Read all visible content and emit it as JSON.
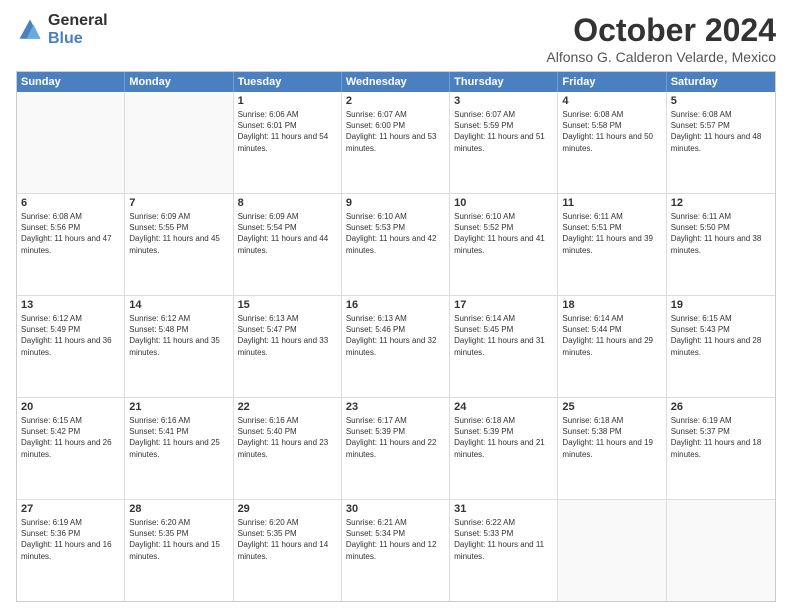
{
  "logo": {
    "general": "General",
    "blue": "Blue"
  },
  "header": {
    "month": "October 2024",
    "location": "Alfonso G. Calderon Velarde, Mexico"
  },
  "weekdays": [
    "Sunday",
    "Monday",
    "Tuesday",
    "Wednesday",
    "Thursday",
    "Friday",
    "Saturday"
  ],
  "weeks": [
    [
      {
        "day": "",
        "sunrise": "",
        "sunset": "",
        "daylight": ""
      },
      {
        "day": "",
        "sunrise": "",
        "sunset": "",
        "daylight": ""
      },
      {
        "day": "1",
        "sunrise": "Sunrise: 6:06 AM",
        "sunset": "Sunset: 6:01 PM",
        "daylight": "Daylight: 11 hours and 54 minutes."
      },
      {
        "day": "2",
        "sunrise": "Sunrise: 6:07 AM",
        "sunset": "Sunset: 6:00 PM",
        "daylight": "Daylight: 11 hours and 53 minutes."
      },
      {
        "day": "3",
        "sunrise": "Sunrise: 6:07 AM",
        "sunset": "Sunset: 5:59 PM",
        "daylight": "Daylight: 11 hours and 51 minutes."
      },
      {
        "day": "4",
        "sunrise": "Sunrise: 6:08 AM",
        "sunset": "Sunset: 5:58 PM",
        "daylight": "Daylight: 11 hours and 50 minutes."
      },
      {
        "day": "5",
        "sunrise": "Sunrise: 6:08 AM",
        "sunset": "Sunset: 5:57 PM",
        "daylight": "Daylight: 11 hours and 48 minutes."
      }
    ],
    [
      {
        "day": "6",
        "sunrise": "Sunrise: 6:08 AM",
        "sunset": "Sunset: 5:56 PM",
        "daylight": "Daylight: 11 hours and 47 minutes."
      },
      {
        "day": "7",
        "sunrise": "Sunrise: 6:09 AM",
        "sunset": "Sunset: 5:55 PM",
        "daylight": "Daylight: 11 hours and 45 minutes."
      },
      {
        "day": "8",
        "sunrise": "Sunrise: 6:09 AM",
        "sunset": "Sunset: 5:54 PM",
        "daylight": "Daylight: 11 hours and 44 minutes."
      },
      {
        "day": "9",
        "sunrise": "Sunrise: 6:10 AM",
        "sunset": "Sunset: 5:53 PM",
        "daylight": "Daylight: 11 hours and 42 minutes."
      },
      {
        "day": "10",
        "sunrise": "Sunrise: 6:10 AM",
        "sunset": "Sunset: 5:52 PM",
        "daylight": "Daylight: 11 hours and 41 minutes."
      },
      {
        "day": "11",
        "sunrise": "Sunrise: 6:11 AM",
        "sunset": "Sunset: 5:51 PM",
        "daylight": "Daylight: 11 hours and 39 minutes."
      },
      {
        "day": "12",
        "sunrise": "Sunrise: 6:11 AM",
        "sunset": "Sunset: 5:50 PM",
        "daylight": "Daylight: 11 hours and 38 minutes."
      }
    ],
    [
      {
        "day": "13",
        "sunrise": "Sunrise: 6:12 AM",
        "sunset": "Sunset: 5:49 PM",
        "daylight": "Daylight: 11 hours and 36 minutes."
      },
      {
        "day": "14",
        "sunrise": "Sunrise: 6:12 AM",
        "sunset": "Sunset: 5:48 PM",
        "daylight": "Daylight: 11 hours and 35 minutes."
      },
      {
        "day": "15",
        "sunrise": "Sunrise: 6:13 AM",
        "sunset": "Sunset: 5:47 PM",
        "daylight": "Daylight: 11 hours and 33 minutes."
      },
      {
        "day": "16",
        "sunrise": "Sunrise: 6:13 AM",
        "sunset": "Sunset: 5:46 PM",
        "daylight": "Daylight: 11 hours and 32 minutes."
      },
      {
        "day": "17",
        "sunrise": "Sunrise: 6:14 AM",
        "sunset": "Sunset: 5:45 PM",
        "daylight": "Daylight: 11 hours and 31 minutes."
      },
      {
        "day": "18",
        "sunrise": "Sunrise: 6:14 AM",
        "sunset": "Sunset: 5:44 PM",
        "daylight": "Daylight: 11 hours and 29 minutes."
      },
      {
        "day": "19",
        "sunrise": "Sunrise: 6:15 AM",
        "sunset": "Sunset: 5:43 PM",
        "daylight": "Daylight: 11 hours and 28 minutes."
      }
    ],
    [
      {
        "day": "20",
        "sunrise": "Sunrise: 6:15 AM",
        "sunset": "Sunset: 5:42 PM",
        "daylight": "Daylight: 11 hours and 26 minutes."
      },
      {
        "day": "21",
        "sunrise": "Sunrise: 6:16 AM",
        "sunset": "Sunset: 5:41 PM",
        "daylight": "Daylight: 11 hours and 25 minutes."
      },
      {
        "day": "22",
        "sunrise": "Sunrise: 6:16 AM",
        "sunset": "Sunset: 5:40 PM",
        "daylight": "Daylight: 11 hours and 23 minutes."
      },
      {
        "day": "23",
        "sunrise": "Sunrise: 6:17 AM",
        "sunset": "Sunset: 5:39 PM",
        "daylight": "Daylight: 11 hours and 22 minutes."
      },
      {
        "day": "24",
        "sunrise": "Sunrise: 6:18 AM",
        "sunset": "Sunset: 5:39 PM",
        "daylight": "Daylight: 11 hours and 21 minutes."
      },
      {
        "day": "25",
        "sunrise": "Sunrise: 6:18 AM",
        "sunset": "Sunset: 5:38 PM",
        "daylight": "Daylight: 11 hours and 19 minutes."
      },
      {
        "day": "26",
        "sunrise": "Sunrise: 6:19 AM",
        "sunset": "Sunset: 5:37 PM",
        "daylight": "Daylight: 11 hours and 18 minutes."
      }
    ],
    [
      {
        "day": "27",
        "sunrise": "Sunrise: 6:19 AM",
        "sunset": "Sunset: 5:36 PM",
        "daylight": "Daylight: 11 hours and 16 minutes."
      },
      {
        "day": "28",
        "sunrise": "Sunrise: 6:20 AM",
        "sunset": "Sunset: 5:35 PM",
        "daylight": "Daylight: 11 hours and 15 minutes."
      },
      {
        "day": "29",
        "sunrise": "Sunrise: 6:20 AM",
        "sunset": "Sunset: 5:35 PM",
        "daylight": "Daylight: 11 hours and 14 minutes."
      },
      {
        "day": "30",
        "sunrise": "Sunrise: 6:21 AM",
        "sunset": "Sunset: 5:34 PM",
        "daylight": "Daylight: 11 hours and 12 minutes."
      },
      {
        "day": "31",
        "sunrise": "Sunrise: 6:22 AM",
        "sunset": "Sunset: 5:33 PM",
        "daylight": "Daylight: 11 hours and 11 minutes."
      },
      {
        "day": "",
        "sunrise": "",
        "sunset": "",
        "daylight": ""
      },
      {
        "day": "",
        "sunrise": "",
        "sunset": "",
        "daylight": ""
      }
    ]
  ]
}
